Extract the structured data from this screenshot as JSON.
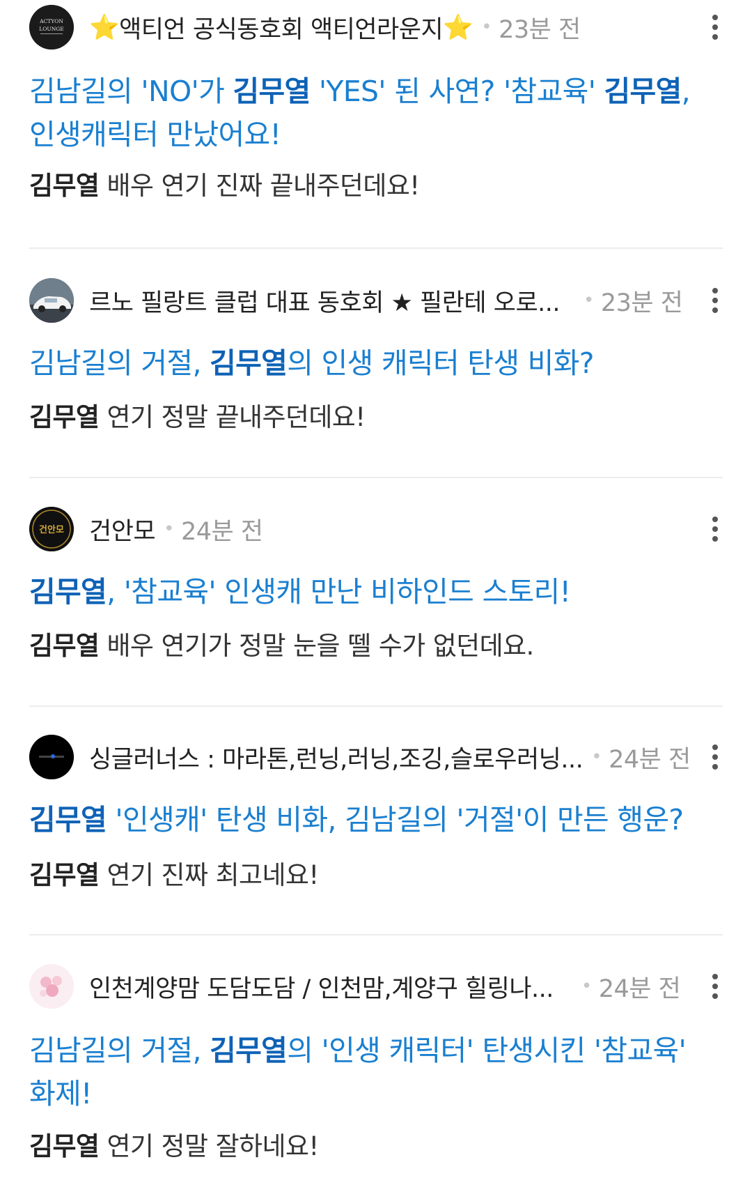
{
  "posts": [
    {
      "author_prefix": "⭐",
      "author": "액티언 공식동호회 액티언라운지",
      "author_suffix": "⭐",
      "time": "23분 전",
      "avatar_text": "ACTYON LOUNGE",
      "title": [
        "김남길의 'NO'가 ",
        "김무열",
        " 'YES' 된 사연? '참교육' ",
        "김무열",
        ", 인생캐릭터 만났어요!"
      ],
      "excerpt": [
        "김무열",
        " 배우 연기 진짜 끝내주던데요!"
      ]
    },
    {
      "author": "르노 필랑트 클럽 대표 동호회 ★ 필란테 오로...",
      "time": "23분 전",
      "title": [
        "김남길의 거절, ",
        "김무열",
        "의 인생 캐릭터 탄생 비화?"
      ],
      "excerpt": [
        "김무열",
        " 연기 정말 끝내주던데요!"
      ]
    },
    {
      "author": "건안모",
      "time": "24분 전",
      "avatar_text": "건안모",
      "title": [
        "김무열",
        ", '참교육' 인생캐 만난 비하인드 스토리!"
      ],
      "excerpt": [
        "김무열",
        " 배우 연기가 정말 눈을 뗄 수가 없던데요."
      ]
    },
    {
      "author": "싱글러너스 : 마라톤,런닝,러닝,조깅,슬로우러닝...",
      "time": "24분 전",
      "title": [
        "김무열",
        " '인생캐' 탄생 비화, 김남길의 '거절'이 만든 행운?"
      ],
      "excerpt": [
        "김무열",
        " 연기 진짜 최고네요!"
      ]
    },
    {
      "author": "인천계양맘 도담도담 / 인천맘,계양구 힐링나...",
      "time": "24분 전",
      "title": [
        "김남길의 거절, ",
        "김무열",
        "의 '인생 캐릭터' 탄생시킨 '참교육' 화제!"
      ],
      "excerpt": [
        "김무열",
        " 연기 정말 잘하네요!"
      ]
    }
  ],
  "icons": {
    "more": "more-vertical-icon"
  },
  "colors": {
    "title": "#1a7fd0",
    "highlight": "#0e62b6",
    "time": "#9a9a9a"
  }
}
